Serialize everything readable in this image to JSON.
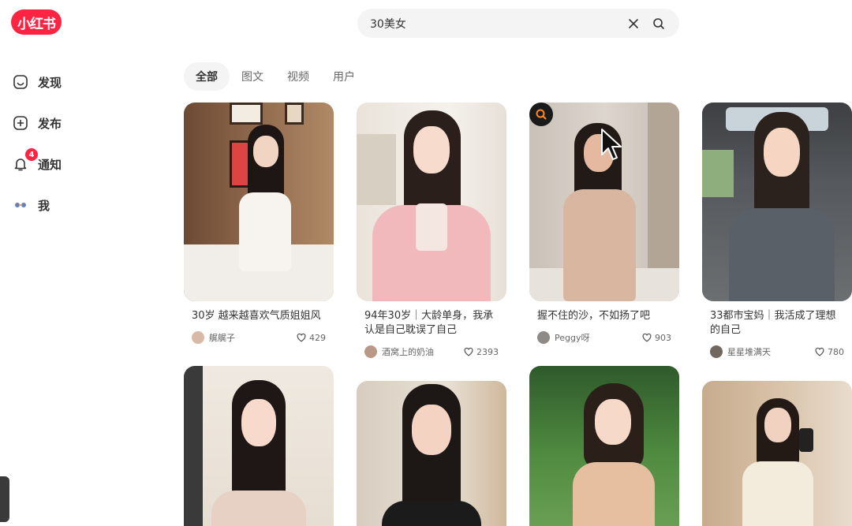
{
  "logo": {
    "text": "小红书"
  },
  "sidebar": {
    "items": [
      {
        "label": "发现",
        "icon": "discover-icon"
      },
      {
        "label": "发布",
        "icon": "plus-square-icon"
      },
      {
        "label": "通知",
        "icon": "bell-icon",
        "badge": "4"
      },
      {
        "label": "我",
        "icon": "profile-icon"
      }
    ]
  },
  "search": {
    "value": "30美女",
    "clear_icon": "close-icon",
    "search_icon": "search-icon"
  },
  "tabs": [
    {
      "label": "全部",
      "active": true
    },
    {
      "label": "图文",
      "active": false
    },
    {
      "label": "视频",
      "active": false
    },
    {
      "label": "用户",
      "active": false
    }
  ],
  "cards": [
    {
      "title": "30岁 越来越喜欢气质姐姐风",
      "author": "艉艉子",
      "likes": "429"
    },
    {
      "title": "94年30岁｜大龄单身，我承认是自己耽误了自己",
      "author": "酒窝上的奶油",
      "likes": "2393"
    },
    {
      "title": "握不住的沙，不如扬了吧",
      "author": "Peggy呀",
      "likes": "903"
    },
    {
      "title": "33都市宝妈｜我活成了理想的自己",
      "author": "星星堆满天",
      "likes": "780"
    }
  ],
  "colors": {
    "brand": "#ff2442",
    "tab_active_bg": "#f4f4f4"
  }
}
